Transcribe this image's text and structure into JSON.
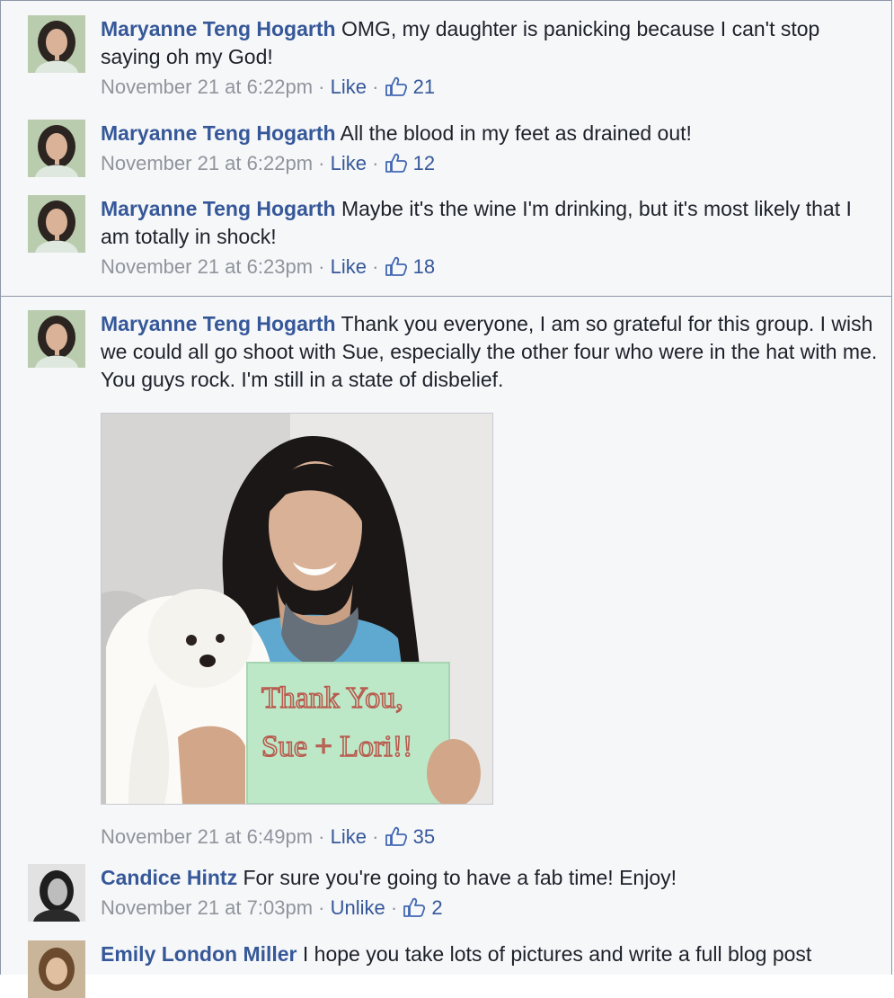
{
  "comments_top": [
    {
      "author": "Maryanne Teng Hogarth",
      "text": "OMG, my daughter is panicking because I can't stop saying oh my God!",
      "time": "November 21 at 6:22pm",
      "action": "Like",
      "likes": "21"
    },
    {
      "author": "Maryanne Teng Hogarth",
      "text": "All the blood in my feet as drained out!",
      "time": "November 21 at 6:22pm",
      "action": "Like",
      "likes": "12"
    },
    {
      "author": "Maryanne Teng Hogarth",
      "text": "Maybe it's the wine I'm drinking, but it's most likely that I am totally in shock!",
      "time": "November 21 at 6:23pm",
      "action": "Like",
      "likes": "18"
    }
  ],
  "main_comment": {
    "author": "Maryanne Teng Hogarth",
    "text": "Thank you everyone, I am so grateful for this group. I wish we could all go shoot with Sue, especially the other four who were in the hat with me. You guys rock. I'm still in a state of disbelief.",
    "photo_sign_line1": "Thank You,",
    "photo_sign_line2": "Sue + Lori!!",
    "time": "November 21 at 6:49pm",
    "action": "Like",
    "likes": "35"
  },
  "replies": [
    {
      "author": "Candice Hintz",
      "text": "For sure you're going to have a fab time! Enjoy!",
      "time": "November 21 at 7:03pm",
      "action": "Unlike",
      "likes": "2"
    },
    {
      "author": "Emily London Miller",
      "text": "I hope you take lots of pictures and write a full blog post"
    }
  ],
  "separator": " · ",
  "icons": {
    "like": "thumbs-up-icon"
  },
  "colors": {
    "name": "#365899",
    "meta": "#90949c",
    "text": "#1d2129",
    "background": "#f6f7f9",
    "border": "#8e97a8"
  }
}
